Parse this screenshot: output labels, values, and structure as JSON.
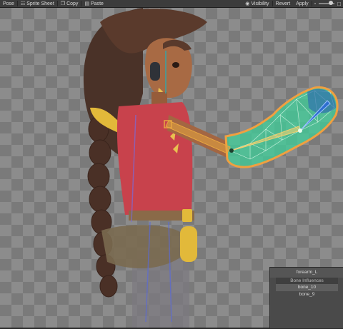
{
  "toolbar": {
    "pose": "Pose",
    "sprite_sheet": "Sprite Sheet",
    "copy": "Copy",
    "paste": "Paste",
    "visibility": "Visibility",
    "revert": "Revert",
    "apply": "Apply"
  },
  "weights_panel": {
    "title": "forearm_L",
    "header": "Bone Influences",
    "bones": [
      "bone_10",
      "bone_9"
    ]
  },
  "colors": {
    "selection_outline": "#f0a040",
    "mesh_fill": "#3fcf9a",
    "bone_color": "#e8a640"
  }
}
